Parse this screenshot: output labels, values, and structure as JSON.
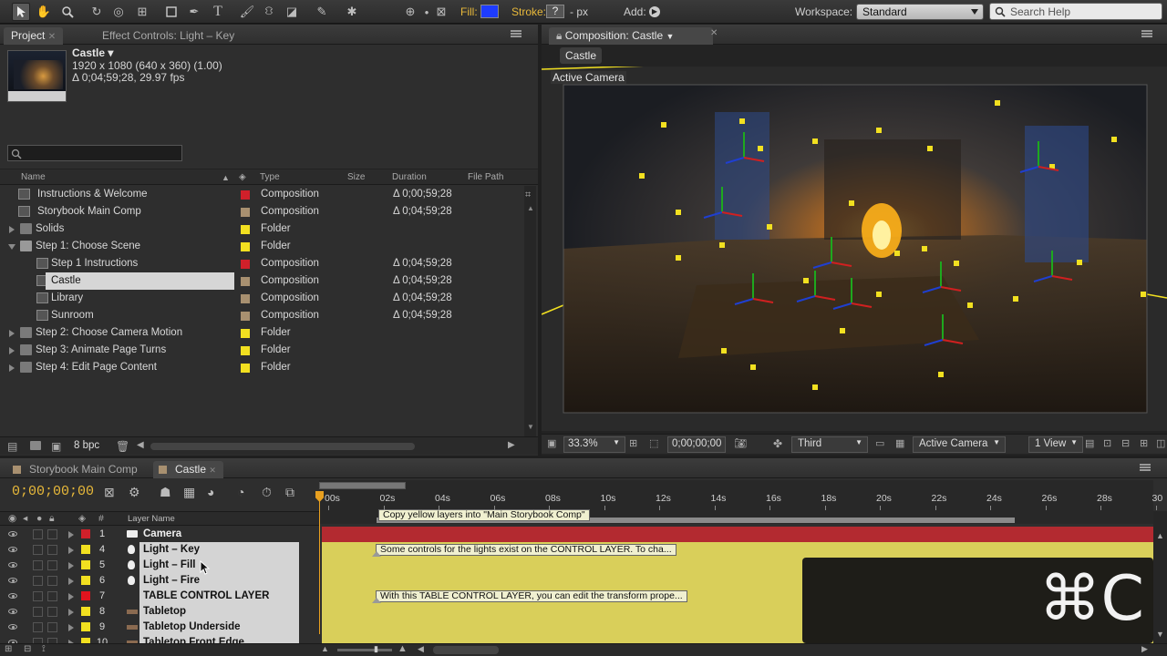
{
  "toolbar": {
    "fill_label": "Fill:",
    "fill_color": "#1e3cff",
    "stroke_label": "Stroke:",
    "stroke_value": "?",
    "stroke_px": "- px",
    "add_label": "Add:",
    "workspace_label": "Workspace:",
    "workspace_value": "Standard",
    "search_placeholder": "Search Help"
  },
  "project_panel": {
    "tab_project": "Project",
    "tab_effect_controls": "Effect Controls: Light – Key",
    "preview": {
      "name": "Castle ▾",
      "resolution": "1920 x 1080  (640 x 360) (1.00)",
      "duration_fps": "Δ 0;04;59;28, 29.97 fps"
    },
    "columns": {
      "name": "Name",
      "type": "Type",
      "size": "Size",
      "duration": "Duration",
      "path": "File Path"
    },
    "items": [
      {
        "name": "Instructions & Welcome",
        "type": "Composition",
        "duration": "Δ 0;00;59;28",
        "color": "#d0202a",
        "kind": "comp",
        "indent": 1
      },
      {
        "name": "Storybook Main Comp",
        "type": "Composition",
        "duration": "Δ 0;04;59;28",
        "color": "#a89070",
        "kind": "comp",
        "indent": 1
      },
      {
        "name": "Solids",
        "type": "Folder",
        "duration": "",
        "color": "#f2e020",
        "kind": "folder",
        "indent": 0
      },
      {
        "name": "Step 1: Choose Scene",
        "type": "Folder",
        "duration": "",
        "color": "#f2e020",
        "kind": "folder-open",
        "indent": 0
      },
      {
        "name": "Step 1 Instructions",
        "type": "Composition",
        "duration": "Δ 0;04;59;28",
        "color": "#d0202a",
        "kind": "comp",
        "indent": 2
      },
      {
        "name": "Castle",
        "type": "Composition",
        "duration": "Δ 0;04;59;28",
        "color": "#a89070",
        "kind": "comp",
        "indent": 2,
        "selected": true
      },
      {
        "name": "Library",
        "type": "Composition",
        "duration": "Δ 0;04;59;28",
        "color": "#a89070",
        "kind": "comp",
        "indent": 2
      },
      {
        "name": "Sunroom",
        "type": "Composition",
        "duration": "Δ 0;04;59;28",
        "color": "#a89070",
        "kind": "comp",
        "indent": 2
      },
      {
        "name": "Step 2: Choose Camera Motion",
        "type": "Folder",
        "duration": "",
        "color": "#f2e020",
        "kind": "folder",
        "indent": 0
      },
      {
        "name": "Step 3: Animate Page Turns",
        "type": "Folder",
        "duration": "",
        "color": "#f2e020",
        "kind": "folder",
        "indent": 0
      },
      {
        "name": "Step 4: Edit Page Content",
        "type": "Folder",
        "duration": "",
        "color": "#f2e020",
        "kind": "folder",
        "indent": 0
      }
    ],
    "bpc": "8 bpc"
  },
  "composition_panel": {
    "tab_label": "Composition: Castle",
    "sub_tab": "Castle",
    "view_label": "Active Camera",
    "zoom": "33.3%",
    "timecode": "0;00;00;00",
    "resolution": "Third",
    "camera": "Active Camera",
    "views": "1 View"
  },
  "timeline": {
    "tabs": [
      "Storybook Main Comp",
      "Castle"
    ],
    "current_time": "0;00;00;00",
    "layer_name_header": "Layer Name",
    "hash_header": "#",
    "ruler": [
      "00s",
      "02s",
      "04s",
      "06s",
      "08s",
      "10s",
      "12s",
      "14s",
      "16s",
      "18s",
      "20s",
      "22s",
      "24s",
      "26s",
      "28s",
      "30"
    ],
    "work_area_note": "Copy yellow layers into \"Main Storybook Comp\"",
    "layers": [
      {
        "num": "1",
        "name": "Camera",
        "color": "#d0202a",
        "kind": "camera",
        "bar": "#b32a30",
        "note": ""
      },
      {
        "num": "4",
        "name": "Light – Key",
        "color": "#f2e020",
        "kind": "light",
        "bar": "#d9cf5a",
        "note": "Some controls for the lights exist on the CONTROL LAYER. To cha..."
      },
      {
        "num": "5",
        "name": "Light – Fill",
        "color": "#f2e020",
        "kind": "light",
        "bar": "#d9cf5a",
        "note": ""
      },
      {
        "num": "6",
        "name": "Light – Fire",
        "color": "#f2e020",
        "kind": "light",
        "bar": "#d9cf5a",
        "note": ""
      },
      {
        "num": "7",
        "name": "TABLE CONTROL LAYER",
        "color": "#e0141e",
        "kind": "solid",
        "bar": "#d9cf5a",
        "note": "With this TABLE CONTROL LAYER, you can edit the transform prope..."
      },
      {
        "num": "8",
        "name": "Tabletop",
        "color": "#f2e020",
        "kind": "layer",
        "bar": "#d9cf5a",
        "note": ""
      },
      {
        "num": "9",
        "name": "Tabletop Underside",
        "color": "#f2e020",
        "kind": "layer",
        "bar": "#d9cf5a",
        "note": ""
      },
      {
        "num": "10",
        "name": "Tabletop Front Edge",
        "color": "#f2e020",
        "kind": "layer",
        "bar": "#d9cf5a",
        "note": ""
      }
    ]
  },
  "overlay": {
    "shortcut": "⌘C"
  }
}
